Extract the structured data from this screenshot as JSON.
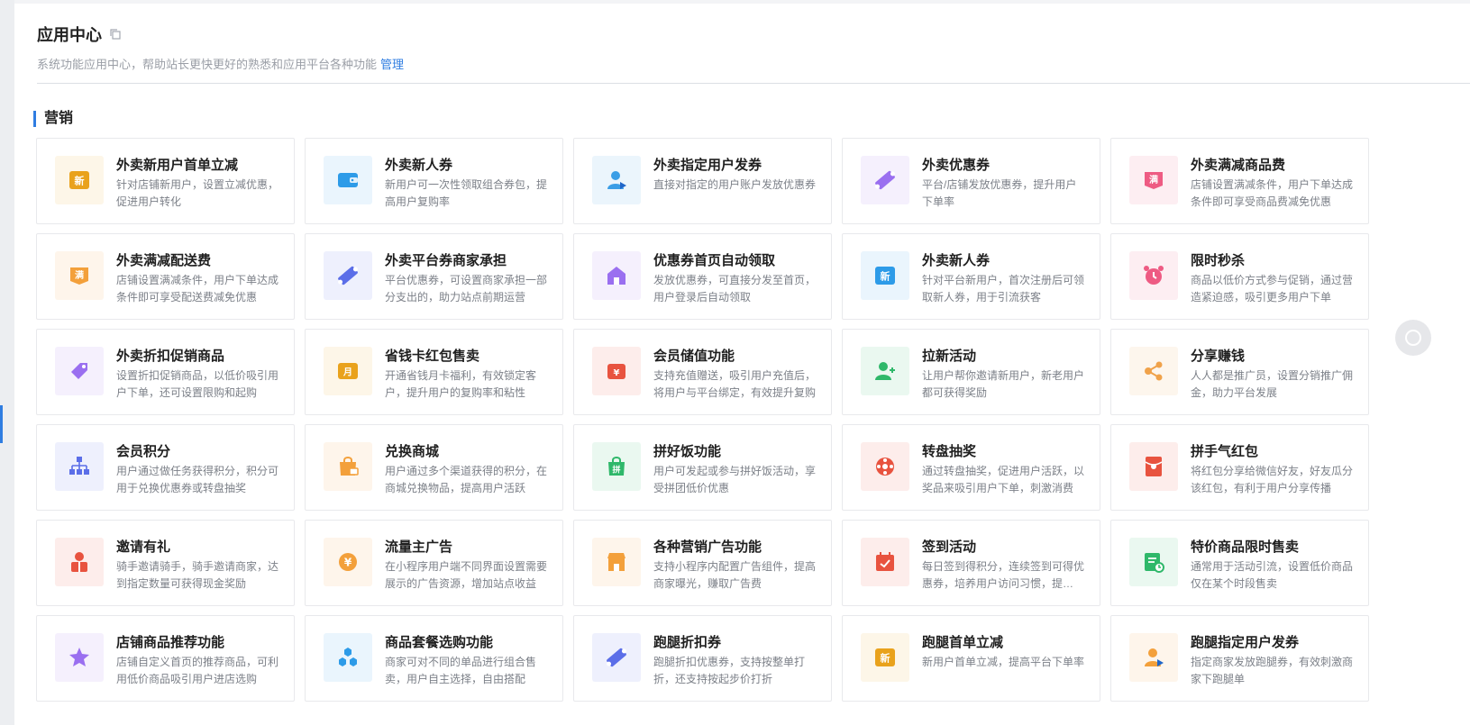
{
  "header": {
    "title": "应用中心",
    "subtitle": "系统功能应用中心，帮助站长更快更好的熟悉和应用平台各种功能",
    "manage_link": "管理"
  },
  "section": {
    "title": "营销"
  },
  "cards": [
    {
      "title": "外卖新用户首单立减",
      "desc": "针对店铺新用户，设置立减优惠，促进用户转化",
      "icon": "new-badge-icon",
      "color": "#e9a21c"
    },
    {
      "title": "外卖新人券",
      "desc": "新用户可一次性领取组合券包，提高用户复购率",
      "icon": "wallet-icon",
      "color": "#2d9be8"
    },
    {
      "title": "外卖指定用户发券",
      "desc": "直接对指定的用户账户发放优惠券",
      "icon": "user-send-icon",
      "color": "#3a9ee6"
    },
    {
      "title": "外卖优惠券",
      "desc": "平台/店铺发放优惠券，提升用户下单率",
      "icon": "ticket-icon",
      "color": "#9a6ff0"
    },
    {
      "title": "外卖满减商品费",
      "desc": "店铺设置满减条件，用户下单达成条件即可享受商品费减免优惠",
      "icon": "full-reduction-icon",
      "color": "#ee5b83"
    },
    {
      "title": "外卖满减配送费",
      "desc": "店铺设置满减条件，用户下单达成条件即可享受配送费减免优惠",
      "icon": "full-reduction-icon",
      "color": "#f3a03b"
    },
    {
      "title": "外卖平台券商家承担",
      "desc": "平台优惠券，可设置商家承担一部分支出的，助力站点前期运营",
      "icon": "ticket-icon",
      "color": "#5b6ee8"
    },
    {
      "title": "优惠券首页自动领取",
      "desc": "发放优惠券，可直接分发至首页，用户登录后自动领取",
      "icon": "home-icon",
      "color": "#9a6ff0"
    },
    {
      "title": "外卖新人券",
      "desc": "针对平台新用户，首次注册后可领取新人券，用于引流获客",
      "icon": "new-badge-icon",
      "color": "#2d9be8"
    },
    {
      "title": "限时秒杀",
      "desc": "商品以低价方式参与促销，通过营造紧迫感，吸引更多用户下单",
      "icon": "alarm-clock-icon",
      "color": "#ee5b83"
    },
    {
      "title": "外卖折扣促销商品",
      "desc": "设置折扣促销商品，以低价吸引用户下单，还可设置限购和起购",
      "icon": "tag-icon",
      "color": "#9a6ff0"
    },
    {
      "title": "省钱卡红包售卖",
      "desc": "开通省钱月卡福利，有效锁定客户，提升用户的复购率和粘性",
      "icon": "month-card-icon",
      "color": "#e9a21c"
    },
    {
      "title": "会员储值功能",
      "desc": "支持充值赠送，吸引用户充值后，将用户与平台绑定，有效提升复购",
      "icon": "stored-value-icon",
      "color": "#e8533f"
    },
    {
      "title": "拉新活动",
      "desc": "让用户帮你邀请新用户，新老用户都可获得奖励",
      "icon": "add-user-icon",
      "color": "#2fb86a"
    },
    {
      "title": "分享赚钱",
      "desc": "人人都是推广员，设置分销推广佣金，助力平台发展",
      "icon": "share-icon",
      "color": "#f0a24a"
    },
    {
      "title": "会员积分",
      "desc": "用户通过做任务获得积分，积分可用于兑换优惠券或转盘抽奖",
      "icon": "org-chart-icon",
      "color": "#5b6ee8"
    },
    {
      "title": "兑换商城",
      "desc": "用户通过多个渠道获得的积分，在商城兑换物品，提高用户活跃",
      "icon": "shopping-bag-icon",
      "color": "#f3a03b"
    },
    {
      "title": "拼好饭功能",
      "desc": "用户可发起或参与拼好饭活动，享受拼团低价优惠",
      "icon": "group-buy-icon",
      "color": "#2fb86a"
    },
    {
      "title": "转盘抽奖",
      "desc": "通过转盘抽奖，促进用户活跃，以奖品来吸引用户下单，刺激消费",
      "icon": "wheel-icon",
      "color": "#e8533f"
    },
    {
      "title": "拼手气红包",
      "desc": "将红包分享给微信好友，好友瓜分该红包，有利于用户分享传播",
      "icon": "red-envelope-icon",
      "color": "#e8533f"
    },
    {
      "title": "邀请有礼",
      "desc": "骑手邀请骑手，骑手邀请商家，达到指定数量可获得现金奖励",
      "icon": "invite-gift-icon",
      "color": "#e8533f"
    },
    {
      "title": "流量主广告",
      "desc": "在小程序用户端不同界面设置需要展示的广告资源，增加站点收益",
      "icon": "coin-icon",
      "color": "#f3a03b"
    },
    {
      "title": "各种营销广告功能",
      "desc": "支持小程序内配置广告组件，提高商家曝光，赚取广告费",
      "icon": "store-icon",
      "color": "#f3a03b"
    },
    {
      "title": "签到活动",
      "desc": "每日签到得积分，连续签到可得优惠券，培养用户访问习惯，提升活跃",
      "icon": "calendar-check-icon",
      "color": "#e8533f"
    },
    {
      "title": "特价商品限时售卖",
      "desc": "通常用于活动引流，设置低价商品仅在某个时段售卖",
      "icon": "timed-list-icon",
      "color": "#2fb86a"
    },
    {
      "title": "店铺商品推荐功能",
      "desc": "店铺自定义首页的推荐商品，可利用低价商品吸引用户进店选购",
      "icon": "star-recommend-icon",
      "color": "#9a6ff0"
    },
    {
      "title": "商品套餐选购功能",
      "desc": "商家可对不同的单品进行组合售卖，用户自主选择，自由搭配",
      "icon": "hexagon-combo-icon",
      "color": "#2d9be8"
    },
    {
      "title": "跑腿折扣券",
      "desc": "跑腿折扣优惠券，支持按整单打折，还支持按起步价打折",
      "icon": "ticket-icon",
      "color": "#5b6ee8"
    },
    {
      "title": "跑腿首单立减",
      "desc": "新用户首单立减，提高平台下单率",
      "icon": "new-badge-icon",
      "color": "#e9a21c"
    },
    {
      "title": "跑腿指定用户发券",
      "desc": "指定商家发放跑腿券，有效刺激商家下跑腿单",
      "icon": "user-send-icon",
      "color": "#f3a03b"
    }
  ]
}
